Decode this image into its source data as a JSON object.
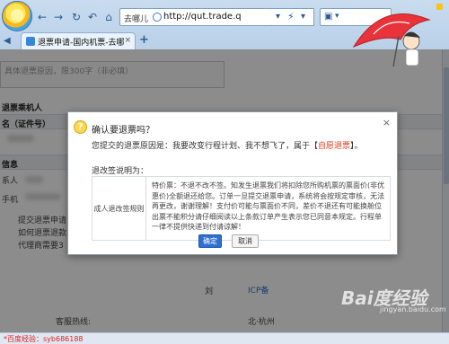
{
  "browser": {
    "address_site": "去哪儿",
    "address_url": "http://qut.trade.q",
    "tab_title": "退票申请-国内机票-去哪儿",
    "new_tab": "+",
    "back_icon": "back-arrow-icon",
    "forward_icon": "forward-arrow-icon",
    "refresh_icon": "refresh-icon",
    "home_icon": "home-icon"
  },
  "page": {
    "reason_line": "具体退票原因，限300字（非必填）",
    "passenger_heading": "退票乘机人",
    "id_label": "名（证件号）",
    "info_heading": "信息",
    "contact_label": "系人",
    "phone_label": "手机",
    "link1": "提交退票申请",
    "link2": "如何退票退款",
    "link3": "代理商需要3",
    "footer_hotline": "客服热线:",
    "footer_icp": "ICP备",
    "footer_right": "北·杭州",
    "footer_col": "刘"
  },
  "dialog": {
    "title": "确认要退票吗？",
    "reason_prefix": "您提交的退票原因是：我要改变行程计划、我不想飞了，属于【",
    "reason_highlight": "自愿退票",
    "reason_suffix": "】。",
    "rule_heading": "退改签说明为：",
    "rule_label": "成人退改签规则",
    "rule_text": "特价票：不退不改不签。知发生退票我们将扣除您所购机票的票面价(非优惠价)全额退还给您。订单一旦提交退票申请，系统将会按规定审核，无法再更改，谢谢理解！支付价可能与票面价不同，差价不退还有可能换舱位出票不能积分请仔细阅读以上条款订单产生表示您已同意本规定。行程单一律不提供快递到付请谅解！",
    "ok_label": "确定",
    "cancel_label": "取消",
    "close_symbol": "×"
  },
  "status_bar": {
    "text": "*百度经验：syb686188"
  },
  "watermark": {
    "text": "Bai度经验",
    "sub": "jingyan.baidu.com"
  }
}
